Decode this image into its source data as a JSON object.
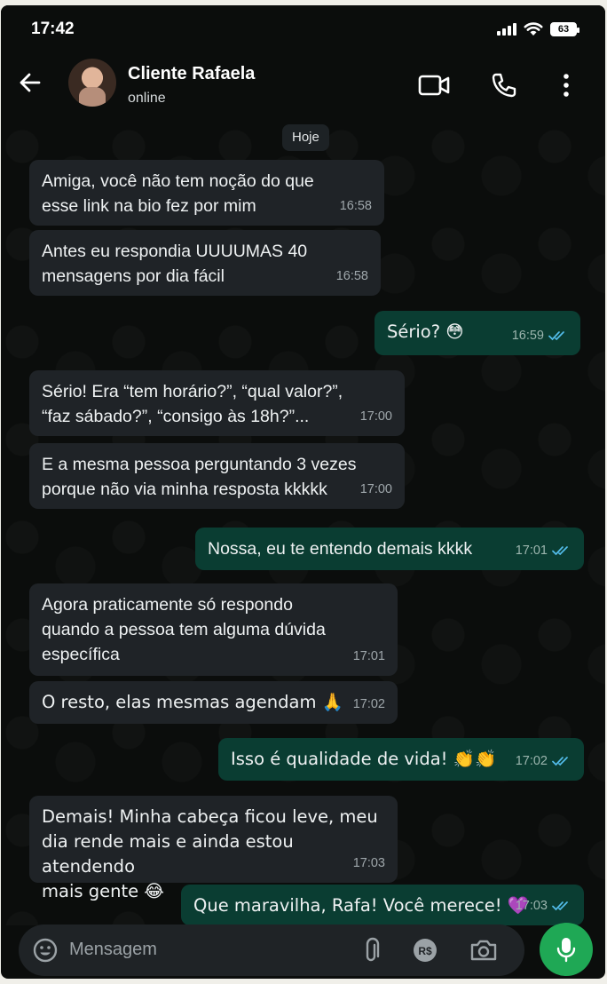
{
  "status_bar": {
    "time": "17:42",
    "battery": "63"
  },
  "header": {
    "contact_name": "Cliente Rafaela",
    "contact_status": "online",
    "icons": [
      "back-arrow-icon",
      "video-call-icon",
      "phone-call-icon",
      "more-options-icon"
    ]
  },
  "chat": {
    "date_chip": "Hoje",
    "messages": [
      {
        "dir": "in",
        "text": "Amiga, você não tem noção do que\nesse link na bio fez por mim",
        "time": "16:58"
      },
      {
        "dir": "in",
        "text": "Antes eu respondia UUUUMAS 40\nmensagens por dia fácil",
        "time": "16:58"
      },
      {
        "dir": "out",
        "text": "Sério? 😳",
        "time": "16:59",
        "read": true
      },
      {
        "dir": "in",
        "text": "Sério! Era “tem horário?”, “qual valor?”,\n“faz sábado?”, “consigo às 18h?”...",
        "time": "17:00"
      },
      {
        "dir": "in",
        "text": "E a mesma pessoa perguntando 3 vezes\nporque não via minha resposta kkkkk",
        "time": "17:00"
      },
      {
        "dir": "out",
        "text": "Nossa, eu te entendo demais kkkk",
        "time": "17:01",
        "read": true
      },
      {
        "dir": "in",
        "text": "Agora praticamente só respondo\nquando a pessoa tem alguma dúvida\nespecífica",
        "time": "17:01"
      },
      {
        "dir": "in",
        "text": "O resto, elas mesmas agendam 🙏",
        "time": "17:02"
      },
      {
        "dir": "out",
        "text": "Isso é qualidade de vida! 👏👏",
        "time": "17:02",
        "read": true
      },
      {
        "dir": "in",
        "text": "Demais! Minha cabeça ficou leve, meu\ndia rende mais e ainda estou atendendo\nmais gente 😂",
        "time": "17:03"
      },
      {
        "dir": "out",
        "text": "Que maravilha, Rafa! Você merece! 💜",
        "time": "17:03",
        "read": true
      }
    ]
  },
  "input": {
    "placeholder": "Mensagem",
    "currency_label": "R$"
  },
  "colors": {
    "incoming": "#1f2327",
    "outgoing": "#0a3d32",
    "accent": "#1fa855",
    "read_ticks": "#53bdeb"
  }
}
